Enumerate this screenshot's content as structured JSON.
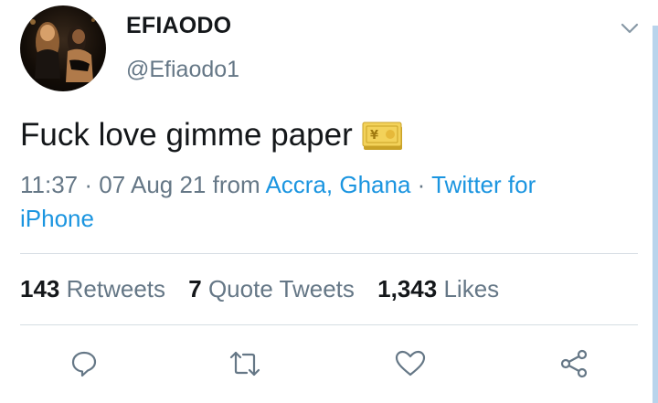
{
  "user": {
    "display_name": "EFIAODO",
    "handle": "@Efiaodo1"
  },
  "tweet": {
    "text": "Fuck love gimme paper",
    "emoji": "money-with-yen-banknote"
  },
  "meta": {
    "time": "11:37",
    "date": "07 Aug 21",
    "from_word": "from",
    "location": "Accra, Ghana",
    "source": "Twitter for iPhone",
    "separator": "·"
  },
  "stats": {
    "retweets_count": "143",
    "retweets_label": "Retweets",
    "quotes_count": "7",
    "quotes_label": "Quote Tweets",
    "likes_count": "1,343",
    "likes_label": "Likes"
  },
  "actions": {
    "reply_icon": "reply-icon",
    "retweet_icon": "retweet-icon",
    "like_icon": "heart-icon",
    "share_icon": "share-icon"
  },
  "colors": {
    "text": "#14171a",
    "secondary": "#657786",
    "link": "#1b95e0",
    "divider": "#d6dde3"
  }
}
